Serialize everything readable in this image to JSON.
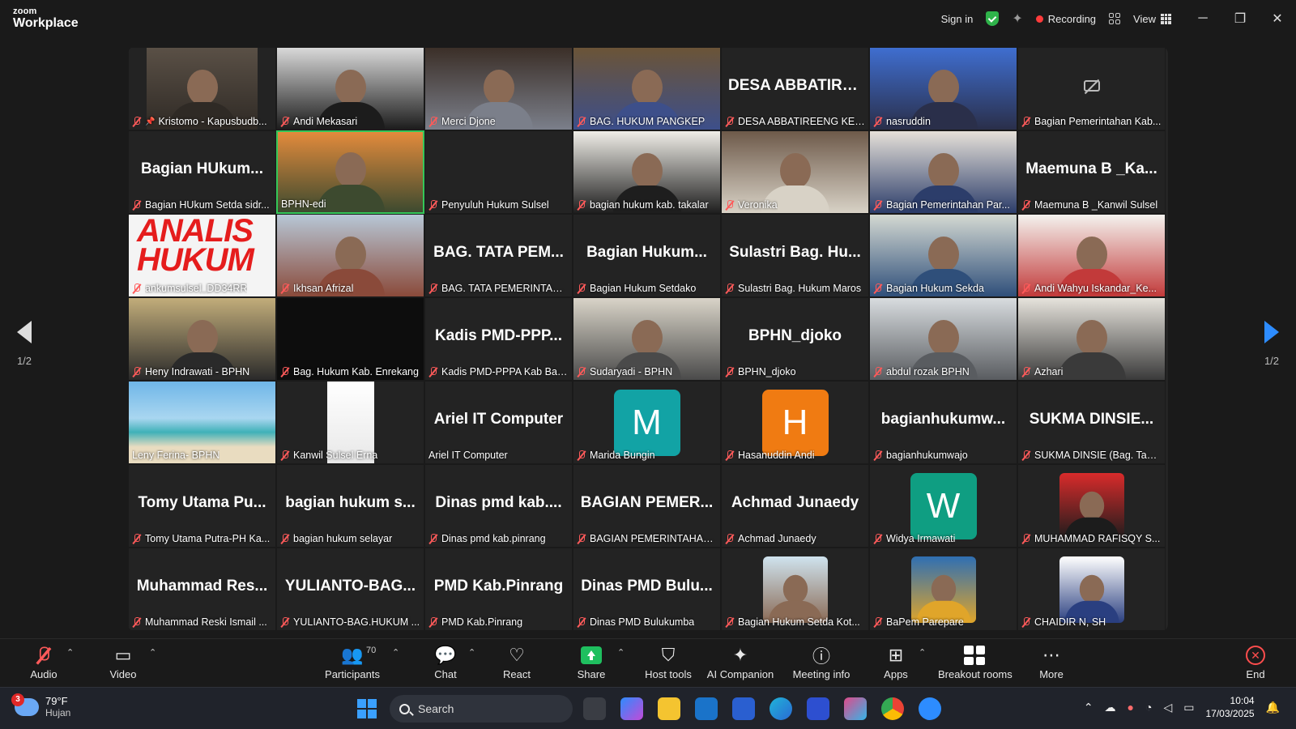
{
  "app": {
    "brand_small": "zoom",
    "brand_big": "Workplace",
    "sign_in": "Sign in",
    "recording": "Recording",
    "view": "View",
    "accent": "#2d8cff",
    "recording_color": "#ff3b3b"
  },
  "grid": {
    "page_left": "1/2",
    "page_right": "1/2",
    "tiles": [
      {
        "name": "Kristomo - Kapusbudb...",
        "muted": true,
        "pinned": true,
        "kind": "photo",
        "c1": "#5a5046",
        "c2": "#2f2a25"
      },
      {
        "name": "Andi Mekasari",
        "muted": true,
        "kind": "person",
        "c1": "#d9d9d9",
        "c2": "#1c1c1c"
      },
      {
        "name": "Merci Djone",
        "muted": true,
        "kind": "person",
        "c1": "#3b2f28",
        "c2": "#7b7f8a"
      },
      {
        "name": "BAG. HUKUM PANGKEP",
        "muted": true,
        "kind": "person",
        "c1": "#6b5437",
        "c2": "#3d4f8a"
      },
      {
        "name": "DESA ABBATIREENG KEC. ...",
        "big": "DESA ABBATIRE...",
        "muted": true,
        "kind": "text"
      },
      {
        "name": "nasruddin",
        "muted": true,
        "kind": "person",
        "c1": "#3f6ed0",
        "c2": "#2a2f4a"
      },
      {
        "name": "Bagian Pemerintahan Kab...",
        "muted": true,
        "kind": "camoff"
      },
      {
        "name": "Bagian HUkum Setda sidr...",
        "big": "Bagian HUkum...",
        "muted": true,
        "kind": "text"
      },
      {
        "name": "BPHN-edi",
        "muted": false,
        "kind": "person",
        "active": true,
        "c1": "#e38b3c",
        "c2": "#3d4a2f"
      },
      {
        "name": "Penyuluh Hukum Sulsel",
        "muted": true,
        "kind": "blank"
      },
      {
        "name": "bagian hukum kab. takalar",
        "muted": true,
        "kind": "person",
        "c1": "#f0eee8",
        "c2": "#1e1e1e"
      },
      {
        "name": "Veronika",
        "muted": true,
        "kind": "person",
        "c1": "#6e5a4a",
        "c2": "#d8d2c6"
      },
      {
        "name": "Bagian Pemerintahan Par...",
        "muted": true,
        "kind": "person",
        "c1": "#e6e1d9",
        "c2": "#2c3d6a"
      },
      {
        "name": "Maemuna B _Kanwil Sulsel",
        "big": "Maemuna B _Ka...",
        "muted": true,
        "kind": "text"
      },
      {
        "name": "ankumsulsel_DD34RR",
        "muted": true,
        "kind": "analis",
        "analis": "ANALIS HUKUM"
      },
      {
        "name": "Ikhsan Afrizal",
        "muted": true,
        "kind": "person",
        "c1": "#b7c7d6",
        "c2": "#8a4a3a"
      },
      {
        "name": "BAG. TATA PEMERINTAHA...",
        "big": "BAG. TATA PEM...",
        "muted": true,
        "kind": "text"
      },
      {
        "name": "Bagian Hukum Setdako",
        "big": "Bagian Hukum...",
        "muted": true,
        "kind": "text"
      },
      {
        "name": "Sulastri Bag. Hukum Maros",
        "big": "Sulastri Bag. Hu...",
        "muted": true,
        "kind": "text"
      },
      {
        "name": "Bagian Hukum Sekda",
        "muted": true,
        "kind": "person",
        "c1": "#d4d9d2",
        "c2": "#2f4f7a"
      },
      {
        "name": "Andi Wahyu Iskandar_Ke...",
        "muted": true,
        "kind": "person",
        "c1": "#f4f2ee",
        "c2": "#c23a3a"
      },
      {
        "name": "Heny Indrawati - BPHN",
        "muted": true,
        "kind": "person",
        "c1": "#c2ad7a",
        "c2": "#2a2a2a"
      },
      {
        "name": "Bag. Hukum Kab. Enrekang",
        "muted": true,
        "kind": "dark"
      },
      {
        "name": "Kadis PMD-PPPA Kab Ban...",
        "big": "Kadis PMD-PPP...",
        "muted": true,
        "kind": "text"
      },
      {
        "name": "Sudaryadi - BPHN",
        "muted": true,
        "kind": "person",
        "c1": "#d9d4c8",
        "c2": "#4a4a4a"
      },
      {
        "name": "BPHN_djoko",
        "big": "BPHN_djoko",
        "muted": true,
        "kind": "text"
      },
      {
        "name": "abdul rozak BPHN",
        "muted": true,
        "kind": "person",
        "c1": "#d8dcdf",
        "c2": "#595c60"
      },
      {
        "name": "Azhari",
        "muted": true,
        "kind": "person",
        "c1": "#e6e3dc",
        "c2": "#3a3a3a"
      },
      {
        "name": "Leny Ferina- BPHN",
        "muted": false,
        "kind": "beach"
      },
      {
        "name": "Kanwil Sulsel Erna",
        "muted": true,
        "kind": "doc"
      },
      {
        "name": "Ariel IT Computer",
        "big": "Ariel IT Computer",
        "muted": false,
        "kind": "text"
      },
      {
        "name": "Marida Bungin",
        "muted": true,
        "kind": "avatar",
        "letter": "M",
        "color": "#12a3a5"
      },
      {
        "name": "Hasanuddin Andi",
        "muted": true,
        "kind": "avatar",
        "letter": "H",
        "color": "#f07b12"
      },
      {
        "name": "bagianhukumwajo",
        "big": "bagianhukumw...",
        "muted": true,
        "kind": "text"
      },
      {
        "name": "SUKMA DINSIE (Bag. Tape...",
        "big": "SUKMA DINSIE...",
        "muted": true,
        "kind": "text"
      },
      {
        "name": "Tomy Utama Putra-PH Ka...",
        "big": "Tomy Utama Pu...",
        "muted": true,
        "kind": "text"
      },
      {
        "name": "bagian hukum selayar",
        "big": "bagian hukum s...",
        "muted": true,
        "kind": "text"
      },
      {
        "name": "Dinas pmd kab.pinrang",
        "big": "Dinas pmd kab....",
        "muted": true,
        "kind": "text"
      },
      {
        "name": "BAGIAN PEMERINTAHAN ...",
        "big": "BAGIAN PEMER...",
        "muted": true,
        "kind": "text"
      },
      {
        "name": "Achmad Junaedy",
        "big": "Achmad Junaedy",
        "muted": true,
        "kind": "text"
      },
      {
        "name": "Widya Irmawati",
        "muted": true,
        "kind": "avatar",
        "letter": "W",
        "color": "#0f9e82"
      },
      {
        "name": "MUHAMMAD RAFISQY S...",
        "muted": true,
        "kind": "portrait",
        "c1": "#d92b2b",
        "c2": "#1c1c1c"
      },
      {
        "name": "Muhammad Reski Ismail ...",
        "big": "Muhammad Res...",
        "muted": true,
        "kind": "text"
      },
      {
        "name": "YULIANTO-BAG.HUKUM ...",
        "big": "YULIANTO-BAG...",
        "muted": true,
        "kind": "text"
      },
      {
        "name": "PMD Kab.Pinrang",
        "big": "PMD Kab.Pinrang",
        "muted": true,
        "kind": "text"
      },
      {
        "name": "Dinas PMD Bulukumba",
        "big": "Dinas PMD Bulu...",
        "muted": true,
        "kind": "text"
      },
      {
        "name": "Bagian Hukum Setda Kot...",
        "muted": true,
        "kind": "portrait",
        "c1": "#cfe3ee",
        "c2": "#8a6a55"
      },
      {
        "name": "BaPem Parepare",
        "muted": true,
        "kind": "portrait",
        "c1": "#2f6fb3",
        "c2": "#e0a52a"
      },
      {
        "name": "CHAIDIR N, SH",
        "muted": true,
        "kind": "portrait",
        "c1": "#ffffff",
        "c2": "#2a3f80"
      }
    ]
  },
  "toolbar": {
    "audio": "Audio",
    "video": "Video",
    "participants": "Participants",
    "participants_count": "70",
    "chat": "Chat",
    "react": "React",
    "share": "Share",
    "host_tools": "Host tools",
    "ai_companion": "AI Companion",
    "meeting_info": "Meeting info",
    "apps": "Apps",
    "breakout_rooms": "Breakout rooms",
    "more": "More",
    "end": "End"
  },
  "taskbar": {
    "weather_temp": "79°F",
    "weather_desc": "Hujan",
    "weather_badge": "3",
    "search_placeholder": "Search",
    "time": "10:04",
    "date": "17/03/2025"
  }
}
